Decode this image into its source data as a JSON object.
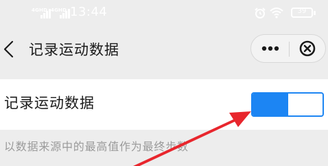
{
  "status_bar": {
    "sim1_label": "4GHD",
    "sim2_label": "4GHD",
    "time": "13:44",
    "battery": "39",
    "icons": [
      "signal-icon",
      "signal-icon",
      "alarm-icon",
      "wifi-icon",
      "battery-icon"
    ]
  },
  "header": {
    "title": "记录运动数据",
    "back_icon": "chevron-left-icon",
    "more_icon": "more-dots-icon",
    "close_icon": "close-circle-icon"
  },
  "setting": {
    "label": "记录运动数据",
    "toggle_on": true,
    "description": "以数据来源中的最高值作为最终步数"
  },
  "colors": {
    "background": "#ededed",
    "card": "#ffffff",
    "accent": "#1c85f3",
    "annotation_arrow": "#e8262d",
    "secondary_text": "#9a9a9a"
  }
}
